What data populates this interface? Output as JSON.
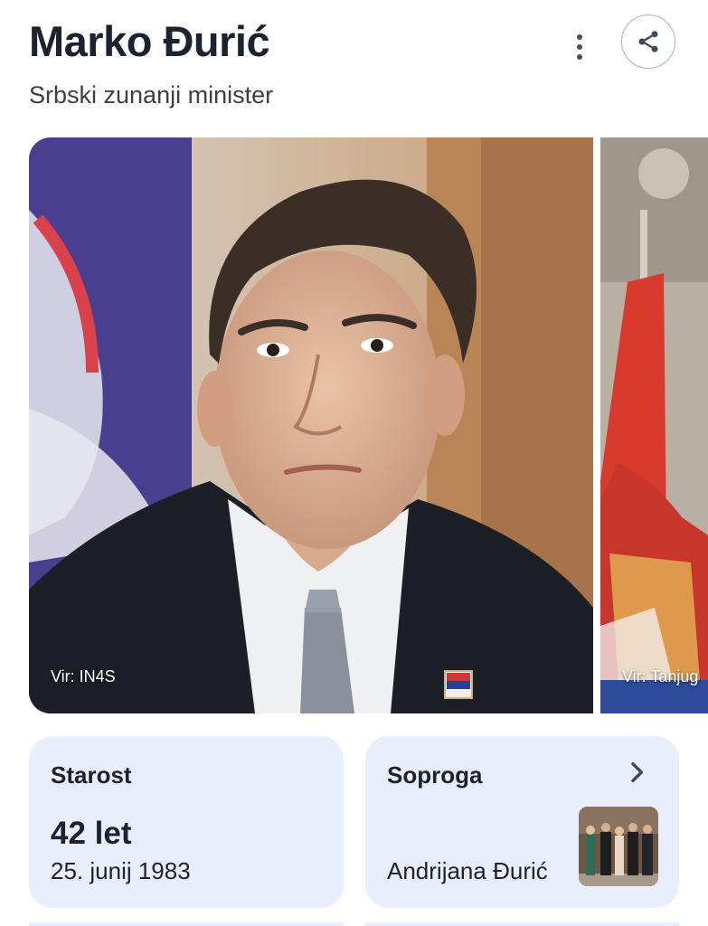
{
  "header": {
    "title": "Marko Đurić",
    "subtitle": "Srbski zunanji minister",
    "more_icon": "more-vert-icon",
    "share_icon": "share-icon"
  },
  "images": [
    {
      "credit": "Vir: IN4S"
    },
    {
      "credit": "Vir: Tanjug"
    }
  ],
  "cards": {
    "age": {
      "label": "Starost",
      "value": "42 let",
      "date": "25. junij 1983"
    },
    "spouse": {
      "label": "Soproga",
      "name": "Andrijana Đurić",
      "icon": "chevron-right-icon"
    }
  },
  "colors": {
    "card_bg": "#e8eefb",
    "title": "#1b2230",
    "share_border": "#9fb3cc"
  }
}
